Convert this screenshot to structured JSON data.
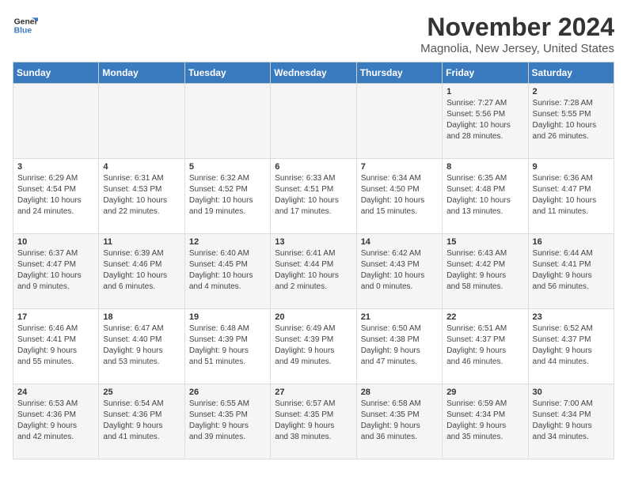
{
  "logo": {
    "line1": "General",
    "line2": "Blue"
  },
  "title": "November 2024",
  "subtitle": "Magnolia, New Jersey, United States",
  "weekdays": [
    "Sunday",
    "Monday",
    "Tuesday",
    "Wednesday",
    "Thursday",
    "Friday",
    "Saturday"
  ],
  "weeks": [
    [
      {
        "day": "",
        "info": ""
      },
      {
        "day": "",
        "info": ""
      },
      {
        "day": "",
        "info": ""
      },
      {
        "day": "",
        "info": ""
      },
      {
        "day": "",
        "info": ""
      },
      {
        "day": "1",
        "info": "Sunrise: 7:27 AM\nSunset: 5:56 PM\nDaylight: 10 hours\nand 28 minutes."
      },
      {
        "day": "2",
        "info": "Sunrise: 7:28 AM\nSunset: 5:55 PM\nDaylight: 10 hours\nand 26 minutes."
      }
    ],
    [
      {
        "day": "3",
        "info": "Sunrise: 6:29 AM\nSunset: 4:54 PM\nDaylight: 10 hours\nand 24 minutes."
      },
      {
        "day": "4",
        "info": "Sunrise: 6:31 AM\nSunset: 4:53 PM\nDaylight: 10 hours\nand 22 minutes."
      },
      {
        "day": "5",
        "info": "Sunrise: 6:32 AM\nSunset: 4:52 PM\nDaylight: 10 hours\nand 19 minutes."
      },
      {
        "day": "6",
        "info": "Sunrise: 6:33 AM\nSunset: 4:51 PM\nDaylight: 10 hours\nand 17 minutes."
      },
      {
        "day": "7",
        "info": "Sunrise: 6:34 AM\nSunset: 4:50 PM\nDaylight: 10 hours\nand 15 minutes."
      },
      {
        "day": "8",
        "info": "Sunrise: 6:35 AM\nSunset: 4:48 PM\nDaylight: 10 hours\nand 13 minutes."
      },
      {
        "day": "9",
        "info": "Sunrise: 6:36 AM\nSunset: 4:47 PM\nDaylight: 10 hours\nand 11 minutes."
      }
    ],
    [
      {
        "day": "10",
        "info": "Sunrise: 6:37 AM\nSunset: 4:47 PM\nDaylight: 10 hours\nand 9 minutes."
      },
      {
        "day": "11",
        "info": "Sunrise: 6:39 AM\nSunset: 4:46 PM\nDaylight: 10 hours\nand 6 minutes."
      },
      {
        "day": "12",
        "info": "Sunrise: 6:40 AM\nSunset: 4:45 PM\nDaylight: 10 hours\nand 4 minutes."
      },
      {
        "day": "13",
        "info": "Sunrise: 6:41 AM\nSunset: 4:44 PM\nDaylight: 10 hours\nand 2 minutes."
      },
      {
        "day": "14",
        "info": "Sunrise: 6:42 AM\nSunset: 4:43 PM\nDaylight: 10 hours\nand 0 minutes."
      },
      {
        "day": "15",
        "info": "Sunrise: 6:43 AM\nSunset: 4:42 PM\nDaylight: 9 hours\nand 58 minutes."
      },
      {
        "day": "16",
        "info": "Sunrise: 6:44 AM\nSunset: 4:41 PM\nDaylight: 9 hours\nand 56 minutes."
      }
    ],
    [
      {
        "day": "17",
        "info": "Sunrise: 6:46 AM\nSunset: 4:41 PM\nDaylight: 9 hours\nand 55 minutes."
      },
      {
        "day": "18",
        "info": "Sunrise: 6:47 AM\nSunset: 4:40 PM\nDaylight: 9 hours\nand 53 minutes."
      },
      {
        "day": "19",
        "info": "Sunrise: 6:48 AM\nSunset: 4:39 PM\nDaylight: 9 hours\nand 51 minutes."
      },
      {
        "day": "20",
        "info": "Sunrise: 6:49 AM\nSunset: 4:39 PM\nDaylight: 9 hours\nand 49 minutes."
      },
      {
        "day": "21",
        "info": "Sunrise: 6:50 AM\nSunset: 4:38 PM\nDaylight: 9 hours\nand 47 minutes."
      },
      {
        "day": "22",
        "info": "Sunrise: 6:51 AM\nSunset: 4:37 PM\nDaylight: 9 hours\nand 46 minutes."
      },
      {
        "day": "23",
        "info": "Sunrise: 6:52 AM\nSunset: 4:37 PM\nDaylight: 9 hours\nand 44 minutes."
      }
    ],
    [
      {
        "day": "24",
        "info": "Sunrise: 6:53 AM\nSunset: 4:36 PM\nDaylight: 9 hours\nand 42 minutes."
      },
      {
        "day": "25",
        "info": "Sunrise: 6:54 AM\nSunset: 4:36 PM\nDaylight: 9 hours\nand 41 minutes."
      },
      {
        "day": "26",
        "info": "Sunrise: 6:55 AM\nSunset: 4:35 PM\nDaylight: 9 hours\nand 39 minutes."
      },
      {
        "day": "27",
        "info": "Sunrise: 6:57 AM\nSunset: 4:35 PM\nDaylight: 9 hours\nand 38 minutes."
      },
      {
        "day": "28",
        "info": "Sunrise: 6:58 AM\nSunset: 4:35 PM\nDaylight: 9 hours\nand 36 minutes."
      },
      {
        "day": "29",
        "info": "Sunrise: 6:59 AM\nSunset: 4:34 PM\nDaylight: 9 hours\nand 35 minutes."
      },
      {
        "day": "30",
        "info": "Sunrise: 7:00 AM\nSunset: 4:34 PM\nDaylight: 9 hours\nand 34 minutes."
      }
    ]
  ]
}
